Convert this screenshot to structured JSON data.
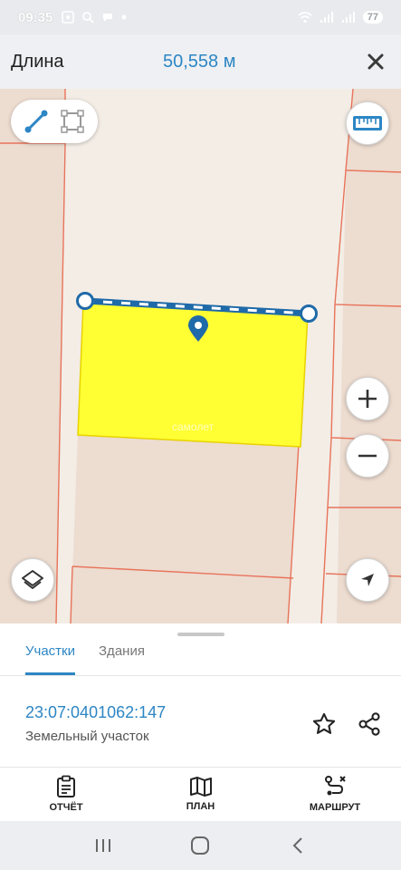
{
  "status_bar": {
    "time": "09:35",
    "battery": "77"
  },
  "header": {
    "title": "Длина",
    "value": "50,558 м"
  },
  "map": {
    "watermark_line1": "самолет",
    "watermark_line2": "плюс"
  },
  "tabs": [
    {
      "label": "Участки",
      "active": true
    },
    {
      "label": "Здания",
      "active": false
    }
  ],
  "parcel": {
    "number": "23:07:0401062:147",
    "type": "Земельный участок"
  },
  "actions": [
    {
      "label": "ОТЧЁТ",
      "icon": "report-icon"
    },
    {
      "label": "ПЛАН",
      "icon": "map-plan-icon"
    },
    {
      "label": "МАРШРУТ",
      "icon": "route-icon"
    }
  ],
  "colors": {
    "accent": "#2d86c4",
    "parcel_fill": "#ffff33",
    "boundary": "#e8735a"
  }
}
